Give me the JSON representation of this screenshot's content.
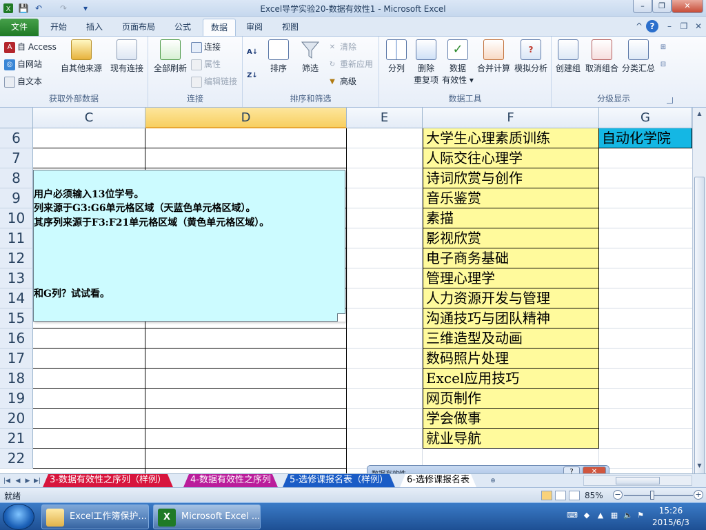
{
  "title_bar": {
    "title": "Excel导学实验20-数据有效性1 - Microsoft Excel",
    "min": "–",
    "restore": "❐",
    "close": "✕"
  },
  "qat": {
    "save": "💾",
    "undo": "↶",
    "redo": "↷",
    "customize": "▾"
  },
  "tabs": [
    {
      "label": "文件"
    },
    {
      "label": "开始"
    },
    {
      "label": "插入"
    },
    {
      "label": "页面布局"
    },
    {
      "label": "公式"
    },
    {
      "label": "数据"
    },
    {
      "label": "审阅"
    },
    {
      "label": "视图"
    }
  ],
  "tab_right": {
    "collapse": "^",
    "help": "?",
    "wmin": "–",
    "wrestore": "❐",
    "wclose": "✕"
  },
  "ribbon": {
    "get_external": {
      "label": "获取外部数据",
      "from_access": "自 Access",
      "from_web": "自网站",
      "from_text": "自文本",
      "other_sources": "自其他来源",
      "existing_connections": "现有连接"
    },
    "connections": {
      "label": "连接",
      "refresh_all": "全部刷新",
      "connections": "连接",
      "properties": "属性",
      "edit_links": "编辑链接"
    },
    "sort_filter": {
      "label": "排序和筛选",
      "sort": "排序",
      "filter": "筛选",
      "clear": "清除",
      "reapply": "重新应用",
      "advanced": "高级"
    },
    "data_tools": {
      "label": "数据工具",
      "text_to_columns": "分列",
      "remove_duplicates_1": "删除",
      "remove_duplicates_2": "重复项",
      "data_validation_1": "数据",
      "data_validation_2": "有效性 ▾",
      "consolidate": "合并计算",
      "what_if": "模拟分析"
    },
    "outline": {
      "label": "分级显示",
      "group": "创建组",
      "ungroup": "取消组合",
      "subtotal": "分类汇总"
    }
  },
  "grid": {
    "columns": [
      "C",
      "D",
      "E",
      "F",
      "G"
    ],
    "rows": [
      "6",
      "7",
      "8",
      "9",
      "10",
      "11",
      "12",
      "13",
      "14",
      "15",
      "16",
      "17",
      "18",
      "19",
      "20",
      "21",
      "22"
    ],
    "f_values": [
      "大学生心理素质训练",
      "人际交往心理学",
      "诗词欣赏与创作",
      "音乐鉴赏",
      "素描",
      "影视欣赏",
      "电子商务基础",
      "管理心理学",
      "人力资源开发与管理",
      "沟通技巧与团队精神",
      "三维造型及动画",
      "数码照片处理",
      "Excel应用技巧",
      "网页制作",
      "学会做事",
      "就业导航"
    ],
    "g6": "自动化学院"
  },
  "comment": {
    "lines": [
      "用户必须输入13位学号。",
      "列来源于G3:G6单元格区域（天蓝色单元格区域）。",
      "其序列来源于F3:F21单元格区域（黄色单元格区域）。",
      "和G列？试试看。"
    ]
  },
  "dialog": {
    "title": "数据有效性",
    "help": "?",
    "close": "✕"
  },
  "sheet_tabs": [
    {
      "label": "3-数据有效性之序列（样例）",
      "style": "red"
    },
    {
      "label": "4-数据有效性之序列",
      "style": "magenta"
    },
    {
      "label": "5-选修课报名表（样例）",
      "style": "blue"
    },
    {
      "label": "6-选修课报名表",
      "style": "active"
    }
  ],
  "status": {
    "ready": "就绪",
    "zoom": "85%",
    "zoom_out": "−",
    "zoom_in": "+"
  },
  "taskbar": {
    "tasks": [
      {
        "label": "Excel工作簿保护..."
      },
      {
        "label": "Microsoft Excel ..."
      }
    ],
    "time": "15:26",
    "date": "2015/6/3"
  },
  "colors": {
    "yellow": "#fffa9c",
    "skyblue": "#14b7e4",
    "comment": "#ccfbff"
  }
}
